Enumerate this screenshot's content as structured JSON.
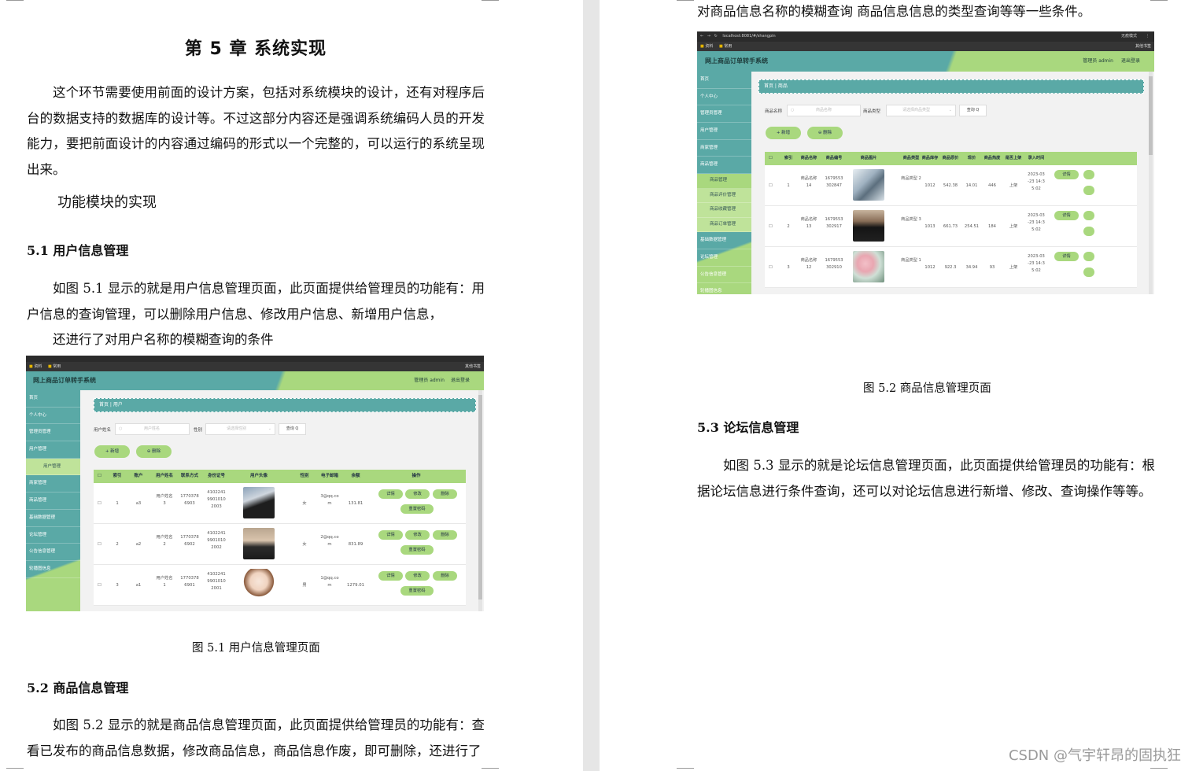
{
  "left_page": {
    "chapter_title": "第 5 章  系统实现",
    "intro_paragraph": "这个环节需要使用前面的设计方案，包括对系统模块的设计，还有对程序后台的数据支持的数据库的设计等。不过这部分内容还是强调系统编码人员的开发能力，要把前面设计的内容通过编码的形式以一个完整的，可以运行的系统呈现出来。",
    "subheading": "功能模块的实现",
    "section_5_1_title": "5.1 用户信息管理",
    "section_5_1_para": "如图 5.1 显示的就是用户信息管理页面，此页面提供给管理员的功能有：用户信息的查询管理，可以删除用户信息、修改用户信息、新增用户信息，",
    "section_5_1_para2": "还进行了对用户名称的模糊查询的条件",
    "figure_5_1_caption": "图 5.1  用户信息管理页面",
    "section_5_2_title": "5.2  商品信息管理",
    "section_5_2_para": "如图 5.2 显示的就是商品信息管理页面，此页面提供给管理员的功能有：查看已发布的商品信息数据，修改商品信息，商品信息作废，即可删除，还进行了"
  },
  "right_page": {
    "continued_text": "对商品信息名称的模糊查询  商品信息信息的类型查询等等一些条件。",
    "figure_5_2_caption": "图 5.2  商品信息管理页面",
    "section_5_3_title": "5.3 论坛信息管理",
    "section_5_3_para": "如图 5.3 显示的就是论坛信息管理页面，此页面提供给管理员的功能有：根据论坛信息进行条件查询，还可以对论坛信息进行新增、修改、查询操作等等。"
  },
  "fig1": {
    "bookmarks": [
      "资料",
      "常用"
    ],
    "bookmark_right": "其他书签",
    "app_title": "网上商品订单转手系统",
    "header_user": "管理员 admin",
    "header_logout": "退出登录",
    "menu": [
      "首页",
      "个人中心",
      "管理员管理",
      "用户管理",
      "用户管理",
      "商家管理",
      "商品管理",
      "基础数据管理",
      "论坛管理",
      "公告信息管理",
      "轮播图信息"
    ],
    "breadcrumb": "首页 | 用户",
    "search_label1": "用户姓名",
    "search_placeholder1": "用户姓名",
    "search_label2": "性别",
    "search_placeholder2": "请选择性别",
    "search_btn": "查询 Q",
    "add_btn": "+ 新增",
    "del_btn": "⊖ 删除",
    "columns": [
      "索引",
      "账户",
      "用户姓名",
      "联系方式",
      "身份证号",
      "用户头像",
      "性别",
      "电子邮箱",
      "余额",
      "操作"
    ],
    "rows": [
      {
        "idx": "1",
        "account": "a3",
        "name": "用户姓名 3",
        "phone": "1770378 6903",
        "idcard": "4102241 9901010 2003",
        "gender": "女",
        "email": "3@qq.co m",
        "balance": "131.81"
      },
      {
        "idx": "2",
        "account": "a2",
        "name": "用户姓名 2",
        "phone": "1770378 6902",
        "idcard": "4102241 9901010 2002",
        "gender": "女",
        "email": "2@qq.co m",
        "balance": "831.89"
      },
      {
        "idx": "3",
        "account": "a1",
        "name": "用户姓名 1",
        "phone": "1770378 6901",
        "idcard": "4102241 9901010 2001",
        "gender": "男",
        "email": "1@qq.co m",
        "balance": "1279.01"
      }
    ],
    "op_detail": "详情",
    "op_edit": "修改",
    "op_delete": "删除",
    "op_reset": "重置密码"
  },
  "fig2": {
    "url": "localhost:8081/#/shangpin",
    "bookmarks": [
      "资料",
      "常用"
    ],
    "bookmark_right": "其他书签",
    "profile": "无痕模式",
    "app_title": "网上商品订单转手系统",
    "header_user": "管理员 admin",
    "header_logout": "退出登录",
    "menu": [
      "首页",
      "个人中心",
      "管理员管理",
      "用户管理",
      "商家管理",
      "商品管理",
      "商品管理",
      "商品评价管理",
      "商品收藏管理",
      "商品订单管理",
      "基础数据管理",
      "论坛管理",
      "公告信息管理",
      "轮播图信息"
    ],
    "breadcrumb": "首页 | 商品",
    "search_label1": "商品名称",
    "search_placeholder1": "商品名称",
    "search_label2": "商品类型",
    "search_placeholder2": "请选择商品类型",
    "search_btn": "查询 Q",
    "add_btn": "+ 新增",
    "del_btn": "⊖ 删除",
    "columns": [
      "索引",
      "商品名称",
      "商品编号",
      "商品图片",
      "商品类型",
      "商品库存",
      "商品原价",
      "现价",
      "商品热度",
      "是否上架",
      "录入时间"
    ],
    "rows": [
      {
        "idx": "1",
        "name": "商品名称 14",
        "code": "1679553 302847",
        "type": "商品类型 2",
        "stock": "1012",
        "orig": "542.38",
        "price": "14.01",
        "heat": "446",
        "onsale": "上架",
        "time": "2023-03 -23 14:3 5:02"
      },
      {
        "idx": "2",
        "name": "商品名称 13",
        "code": "1679553 302917",
        "type": "商品类型 3",
        "stock": "1013",
        "orig": "661.73",
        "price": "254.51",
        "heat": "184",
        "onsale": "上架",
        "time": "2023-03 -23 14:3 5:02"
      },
      {
        "idx": "3",
        "name": "商品名称 12",
        "code": "1679553 302910",
        "type": "商品类型 1",
        "stock": "1012",
        "orig": "922.3",
        "price": "34.94",
        "heat": "93",
        "onsale": "上架",
        "time": "2023-03 -23 14:3 5:02"
      }
    ],
    "op_detail": "详情"
  },
  "watermark": "CSDN @气宇轩昂的固执狂"
}
